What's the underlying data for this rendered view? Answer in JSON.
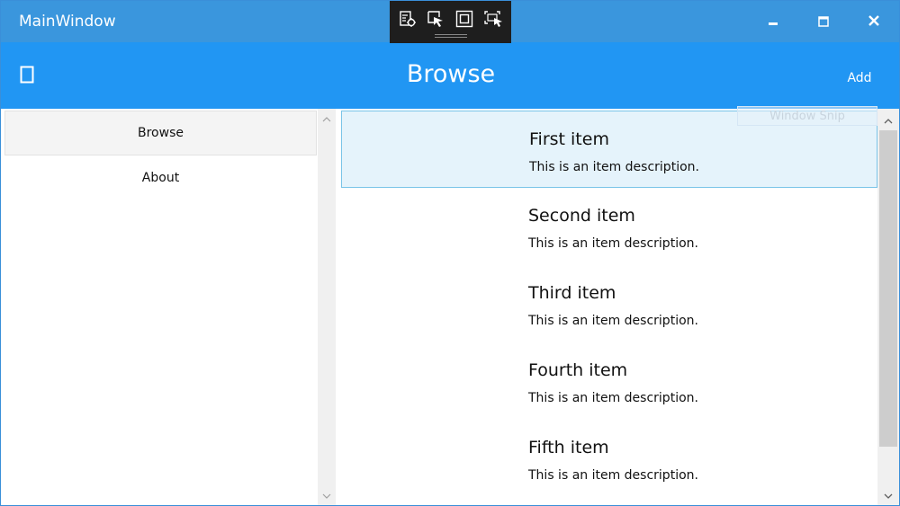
{
  "window": {
    "title": "MainWindow",
    "controls": {
      "minimize_icon": "minimize-icon",
      "maximize_icon": "maximize-icon",
      "close_icon": "close-icon"
    }
  },
  "debug_toolbar": {
    "icons": [
      "live-visual-tree-icon",
      "select-element-icon",
      "display-layout-adorners-icon",
      "track-focus-icon"
    ]
  },
  "appbar": {
    "title": "Browse",
    "add_label": "Add",
    "menu_icon": "hamburger-icon",
    "snip_label": "Window Snip"
  },
  "sidebar": {
    "items": [
      {
        "label": "Browse",
        "selected": true
      },
      {
        "label": "About",
        "selected": false
      }
    ]
  },
  "items": [
    {
      "title": "First item",
      "description": "This is an item description.",
      "selected": true
    },
    {
      "title": "Second item",
      "description": "This is an item description.",
      "selected": false
    },
    {
      "title": "Third item",
      "description": "This is an item description.",
      "selected": false
    },
    {
      "title": "Fourth item",
      "description": "This is an item description.",
      "selected": false
    },
    {
      "title": "Fifth item",
      "description": "This is an item description.",
      "selected": false
    }
  ],
  "colors": {
    "titlebar": "#3a96dd",
    "appbar": "#2196f3",
    "selection": "#e5f3fb",
    "selection_border": "#7ac4e8"
  }
}
